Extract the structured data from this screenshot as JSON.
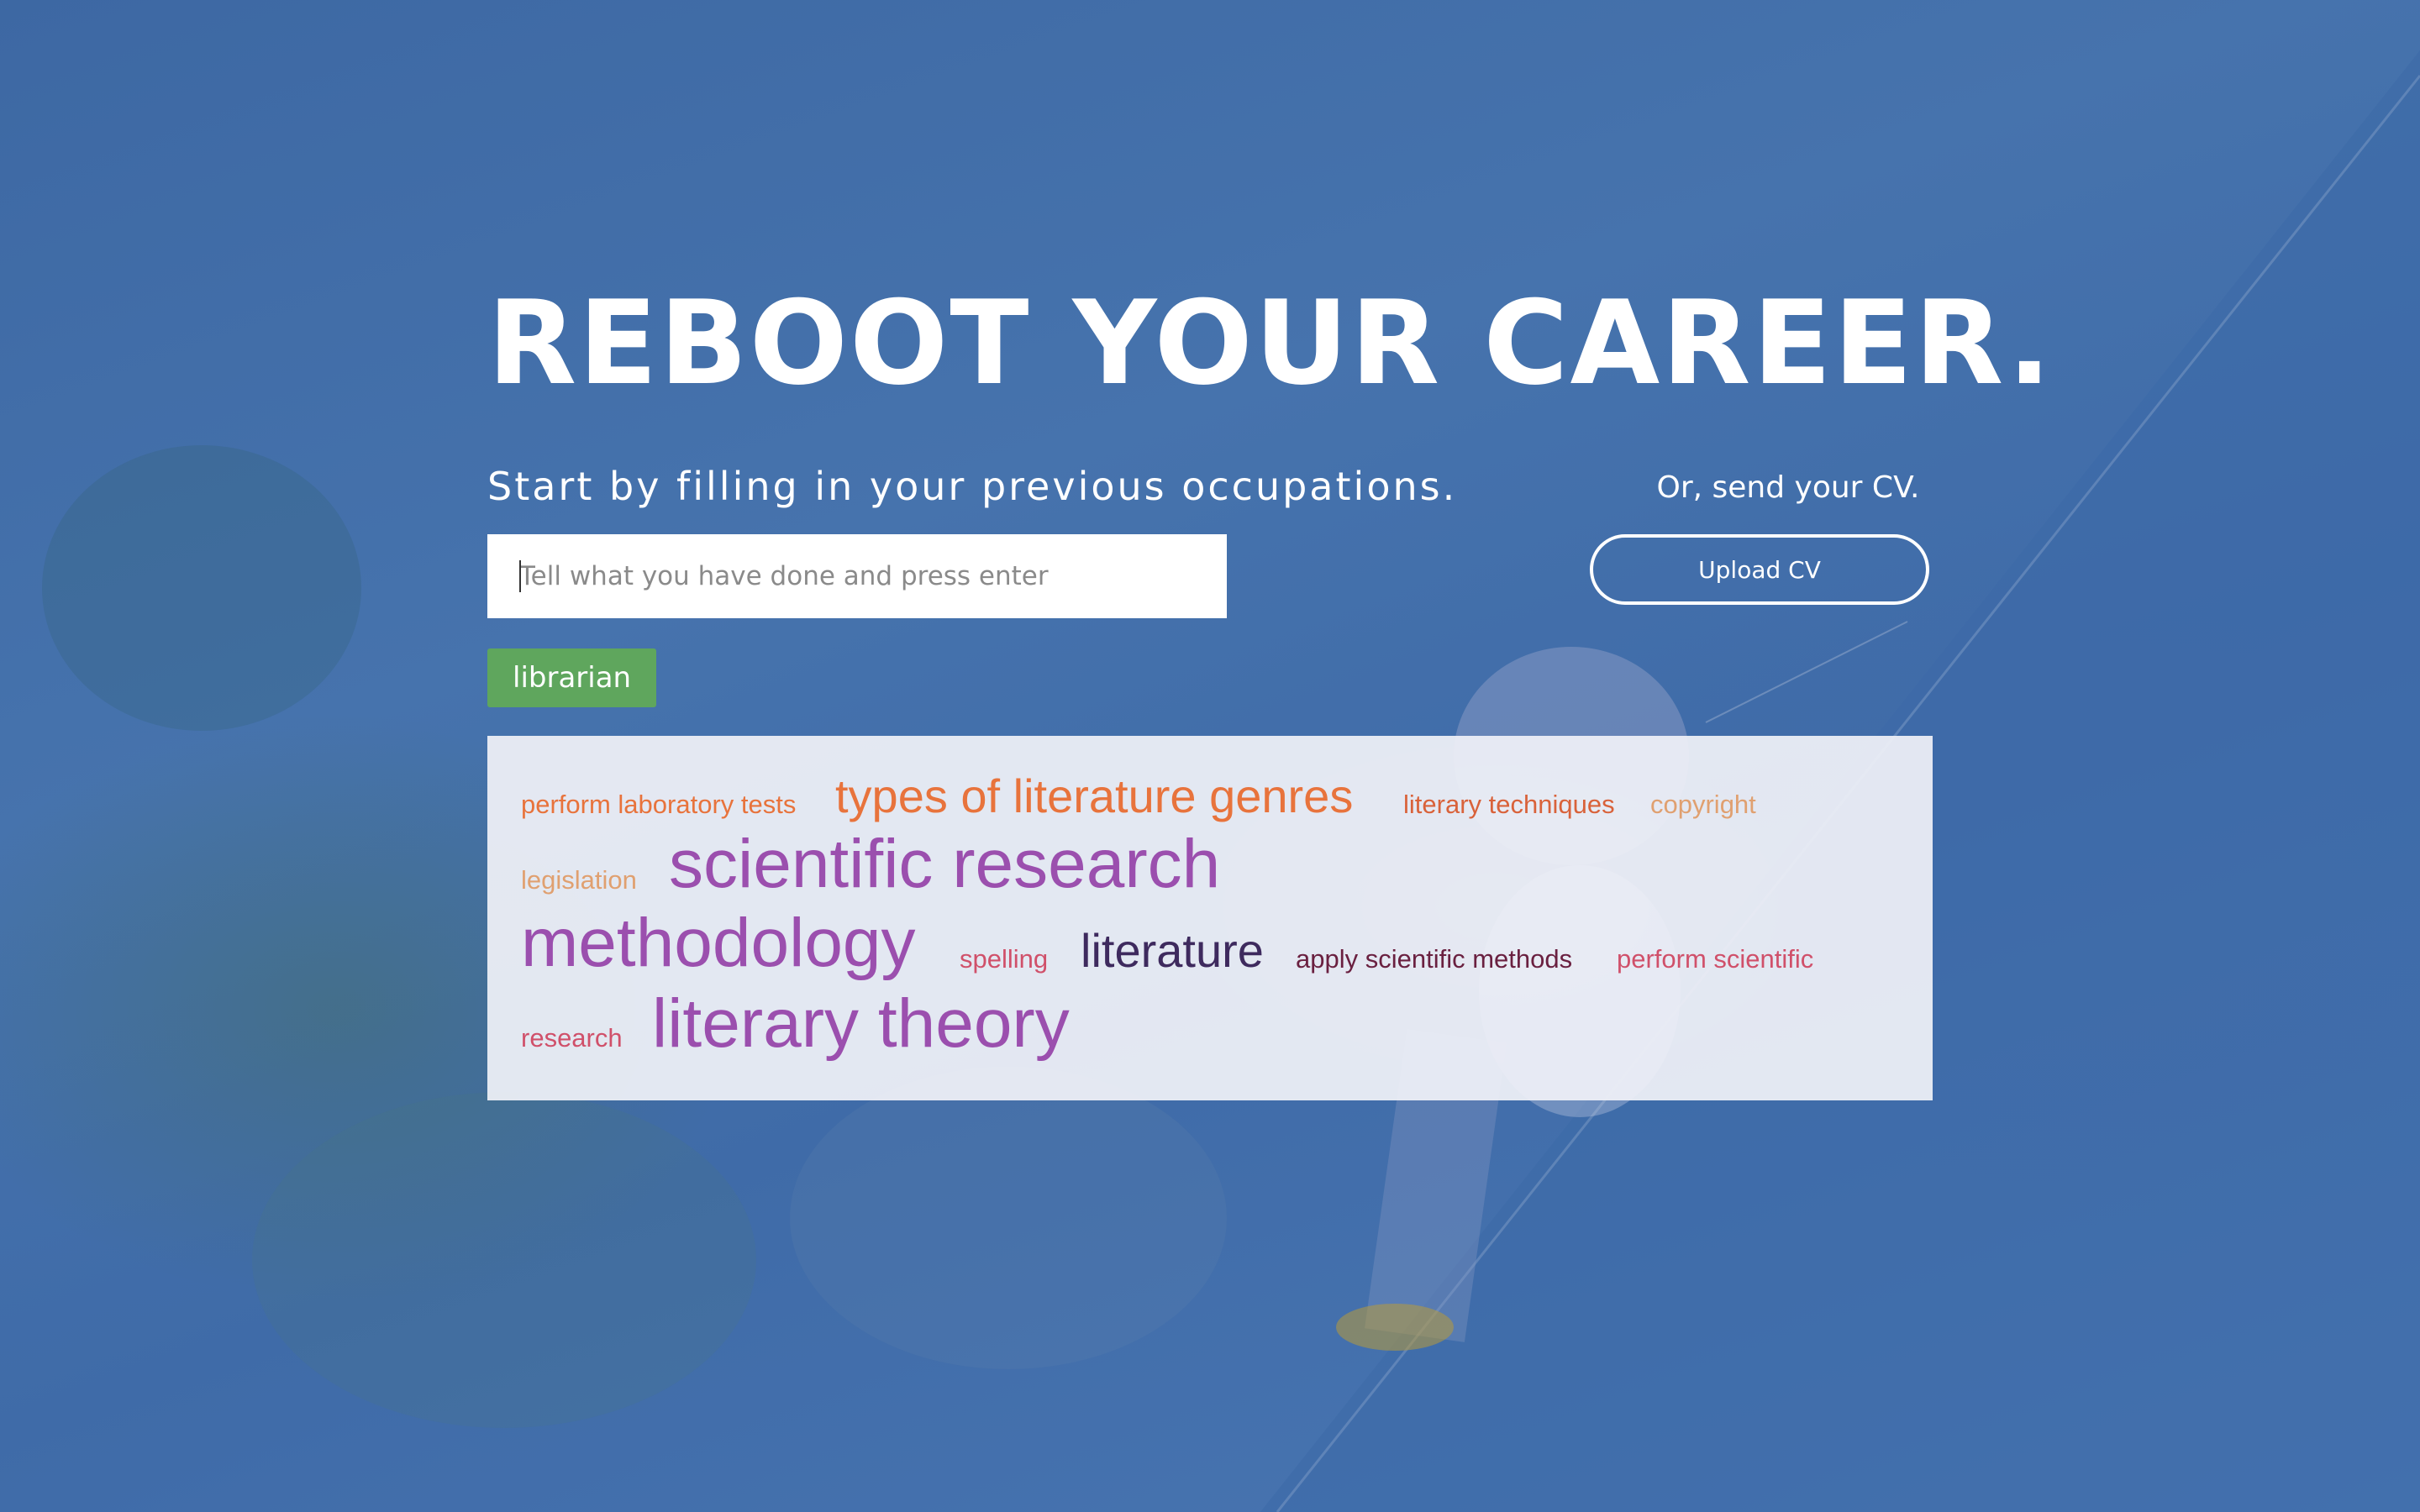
{
  "hero": {
    "title": "REBOOT YOUR CAREER.",
    "subtitle": "Start by filling in your previous occupations.",
    "cv_prompt": "Or, send your CV.",
    "upload_label": "Upload CV"
  },
  "search": {
    "placeholder": "Tell what you have done and press enter",
    "value": ""
  },
  "selected_occupations": [
    "librarian"
  ],
  "skill_cloud": [
    {
      "text": "perform laboratory tests",
      "color": "#e8733c"
    },
    {
      "text": "types of literature genres",
      "color": "#e8733c"
    },
    {
      "text": "literary techniques",
      "color": "#d9623a"
    },
    {
      "text": "copyright",
      "color": "#e0a070"
    },
    {
      "text": "legislation",
      "color": "#e0a070"
    },
    {
      "text": "scientific research",
      "color": "#9b4fae"
    },
    {
      "text": "methodology",
      "color": "#9b4fae"
    },
    {
      "text": "spelling",
      "color": "#d0506a"
    },
    {
      "text": "literature",
      "color": "#3e2a5e"
    },
    {
      "text": "apply scientific methods",
      "color": "#6a2040"
    },
    {
      "text": "perform scientific",
      "color": "#d0506a"
    },
    {
      "text": "research",
      "color": "#d0506a"
    },
    {
      "text": "literary theory",
      "color": "#9b4fae"
    }
  ]
}
